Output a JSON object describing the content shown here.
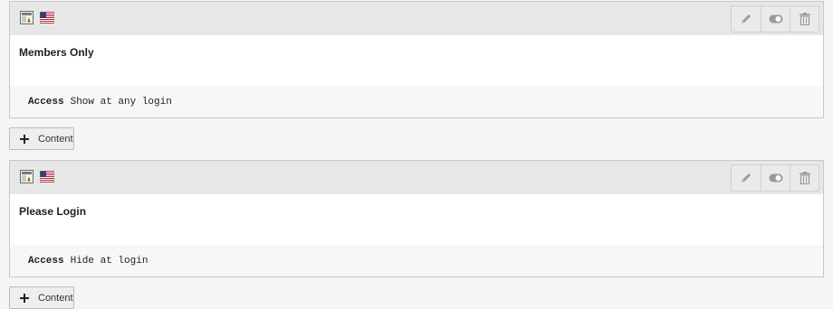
{
  "colors": {
    "header_bg": "#e7e7e7",
    "panel_border": "#c8c8c8",
    "access_row_bg": "#f7f7f7",
    "icon_gray": "#9a9a9a"
  },
  "elements": [
    {
      "title": "Members Only",
      "access_label": "Access",
      "access_value": "Show at any login",
      "type_icon": "content-element-type-icon",
      "language_icon": "us-flag-icon",
      "actions": [
        "edit-icon",
        "toggle-visibility-icon",
        "delete-icon"
      ],
      "add_button_label": "Content"
    },
    {
      "title": "Please Login",
      "access_label": "Access",
      "access_value": "Hide at login",
      "type_icon": "content-element-type-icon",
      "language_icon": "us-flag-icon",
      "actions": [
        "edit-icon",
        "toggle-visibility-icon",
        "delete-icon"
      ],
      "add_button_label": "Content"
    }
  ]
}
